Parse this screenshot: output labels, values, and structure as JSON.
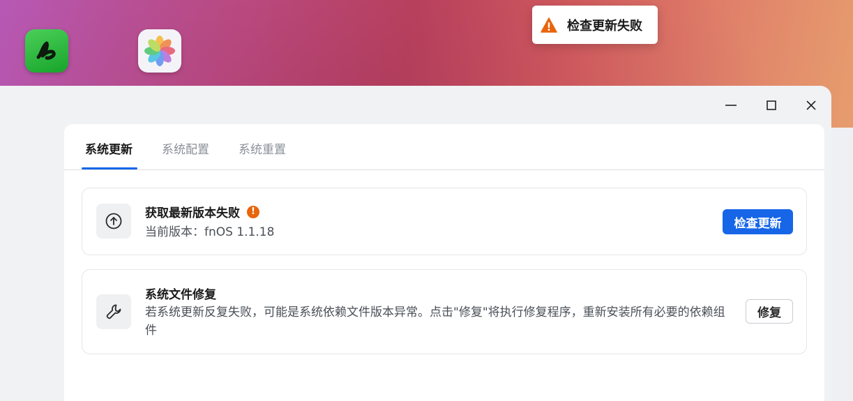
{
  "toast": {
    "icon": "warning-triangle-icon",
    "message": "检查更新失败",
    "color": "#e8650c"
  },
  "desktop": {
    "icons": [
      "green-app-icon",
      "photos-app-icon"
    ]
  },
  "window": {
    "controls": [
      "minimize-icon",
      "maximize-icon",
      "close-icon"
    ]
  },
  "tabs": [
    {
      "label": "系统更新",
      "active": true
    },
    {
      "label": "系统配置",
      "active": false
    },
    {
      "label": "系统重置",
      "active": false
    }
  ],
  "update_card": {
    "icon": "arrow-up-circle-icon",
    "title": "获取最新版本失败",
    "status_icon": "exclamation-circle-icon",
    "status_mark": "!",
    "version_text": "当前版本：fnOS 1.1.18",
    "button_label": "检查更新"
  },
  "repair_card": {
    "icon": "wrench-icon",
    "title": "系统文件修复",
    "description": "若系统更新反复失败，可能是系统依赖文件版本异常。点击\"修复\"将执行修复程序，重新安装所有必要的依赖组件",
    "button_label": "修复"
  },
  "colors": {
    "accent": "#1766e8",
    "warning": "#e8650c"
  }
}
